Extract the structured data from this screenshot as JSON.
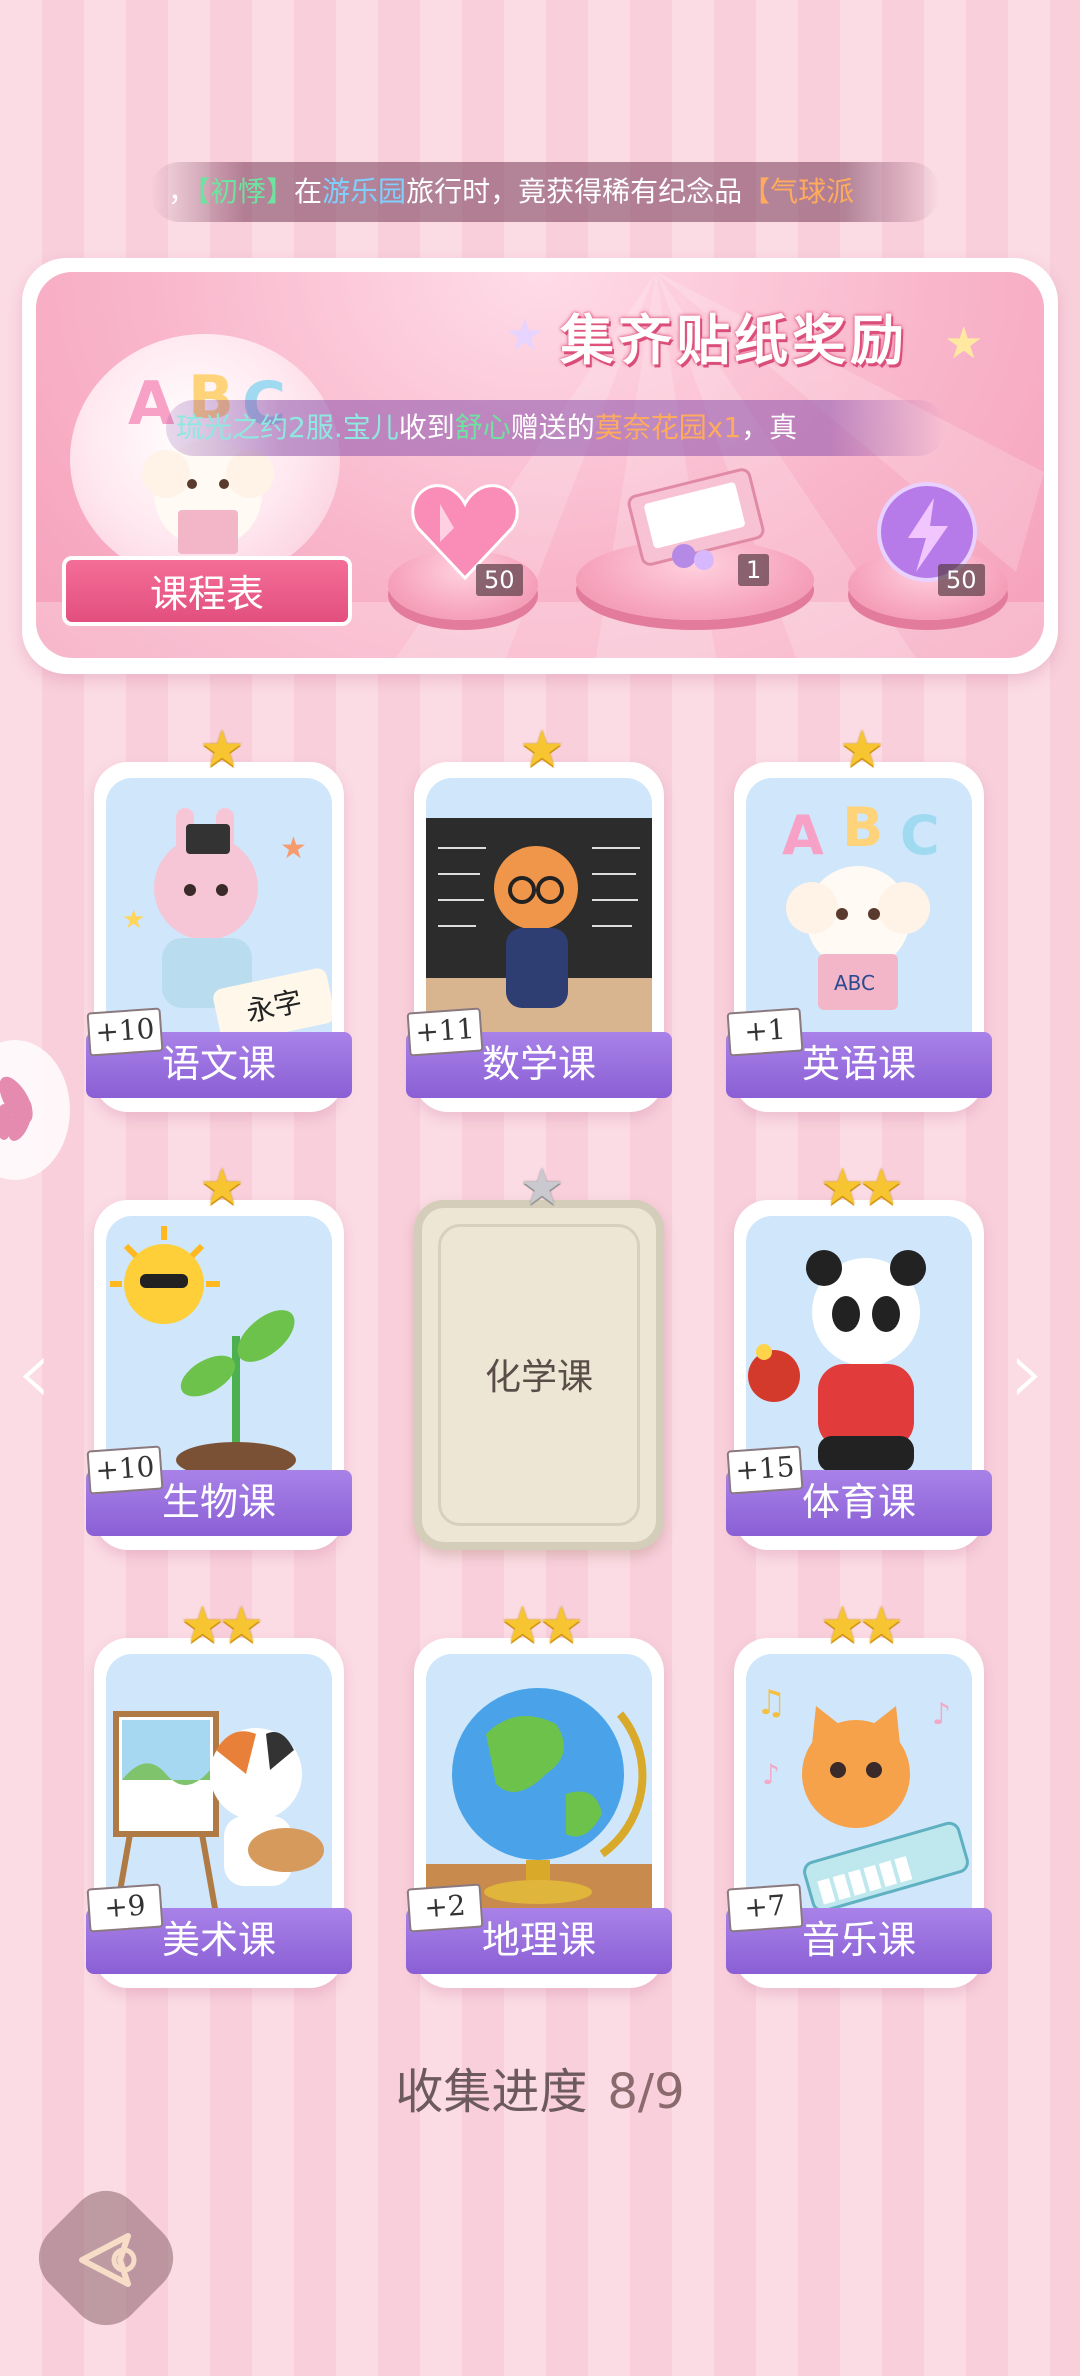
{
  "marquee_top": {
    "prefix": "，",
    "name": "【初悸】",
    "text1": "在",
    "place": "游乐园",
    "text2": "旅行时，竟获得稀有纪念品",
    "item": "【气球派"
  },
  "banner": {
    "title": "集齐贴纸奖励",
    "ribbon_label": "课程表",
    "marquee": {
      "seg1": "琉光之约2服.宝儿",
      "seg2": "收到",
      "seg3": "舒心",
      "seg4": "赠送的",
      "seg5": "莫奈花园x1",
      "seg6": "，真"
    },
    "rewards": [
      {
        "icon": "heart-gem-icon",
        "count": "50"
      },
      {
        "icon": "gift-box-icon",
        "count": "1"
      },
      {
        "icon": "lightning-orb-icon",
        "count": "50"
      }
    ]
  },
  "cards": [
    {
      "label": "语文课",
      "bonus": "+10",
      "stars": "★",
      "art": "rabbit-calligraphy"
    },
    {
      "label": "数学课",
      "bonus": "+11",
      "stars": "★",
      "art": "fox-teacher"
    },
    {
      "label": "英语课",
      "bonus": "+1",
      "stars": "★",
      "art": "poodle-abc"
    },
    {
      "label": "生物课",
      "bonus": "+10",
      "stars": "★",
      "art": "sun-sprout"
    },
    {
      "label": "化学课",
      "bonus": "",
      "stars": "★",
      "art": "locked"
    },
    {
      "label": "体育课",
      "bonus": "+15",
      "stars": "★★",
      "art": "panda-pingpong"
    },
    {
      "label": "美术课",
      "bonus": "+9",
      "stars": "★★",
      "art": "cat-painter"
    },
    {
      "label": "地理课",
      "bonus": "+2",
      "stars": "★★",
      "art": "globe"
    },
    {
      "label": "音乐课",
      "bonus": "+7",
      "stars": "★★",
      "art": "cat-keyboard"
    }
  ],
  "progress": {
    "label": "收集进度",
    "value": "8/9"
  },
  "colors": {
    "label_purple": "#9a70df",
    "star_gold": "#f6c531",
    "banner_pink": "#f59fba"
  }
}
